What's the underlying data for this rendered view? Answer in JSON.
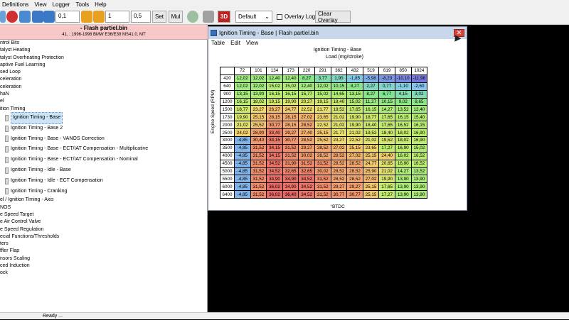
{
  "menu": [
    "Definitions",
    "View",
    "Logger",
    "Tools",
    "Help"
  ],
  "toolbar": {
    "field1": "0,1",
    "field2": "1",
    "field3": "0,5",
    "set_label": "Set",
    "mul_label": "Mul",
    "mode_label": "3D",
    "dropdown_value": "Default",
    "overlay_log_label": "Overlay Log",
    "clear_overlay_label": "Clear Overlay"
  },
  "left_panel": {
    "title": "- Flash partiel.bin",
    "subtitle": "41, ; 1996-1998 BMW E36/E39 MS41.0, MT"
  },
  "tree": [
    {
      "label": "ntrol Bits",
      "child": false
    },
    {
      "label": "talyst Heating",
      "child": false
    },
    {
      "label": "talyst Overheating Protection",
      "child": false
    },
    {
      "label": "aptive Fuel Learning",
      "child": false
    },
    {
      "label": "sed Loop",
      "child": false
    },
    {
      "label": "celeration",
      "child": false
    },
    {
      "label": "celeration",
      "child": false
    },
    {
      "label": "haN",
      "child": false
    },
    {
      "label": "el",
      "child": false
    },
    {
      "label": "ition Timing",
      "child": false
    },
    {
      "label": "Ignition Timing - Base",
      "child": true,
      "selected": true
    },
    {
      "label": "Ignition Timing - Base 2",
      "child": true
    },
    {
      "label": "Ignition Timing - Base - VANOS Correction",
      "child": true
    },
    {
      "label": "Ignition Timing - Base - ECT/IAT Compensation - Multiplicative",
      "child": true
    },
    {
      "label": "Ignition Timing - Base - ECT/IAT Compensation - Nominal",
      "child": true
    },
    {
      "label": "Ignition Timing - Idle - Base",
      "child": true
    },
    {
      "label": "Ignition Timing - Idle - ECT Compensation",
      "child": true
    },
    {
      "label": "Ignition Timing - Cranking",
      "child": true
    },
    {
      "label": "el / Ignition Timing - Axis",
      "child": false
    },
    {
      "label": "NOS",
      "child": false
    },
    {
      "label": "e Speed Target",
      "child": false
    },
    {
      "label": "e Air Control Valve",
      "child": false
    },
    {
      "label": "e Speed Regulation",
      "child": false
    },
    {
      "label": "ecial Functions/Thresholds",
      "child": false
    },
    {
      "label": "ters",
      "child": false
    },
    {
      "label": "ffler Flap",
      "child": false
    },
    {
      "label": "nsors Scaling",
      "child": false
    },
    {
      "label": "ced Induction",
      "child": false
    },
    {
      "label": "ock",
      "child": false
    }
  ],
  "status": "Ready ...",
  "window": {
    "title": "Ignition Timing - Base | Flash partiel.bin",
    "menu": [
      "Table",
      "Edit",
      "View"
    ],
    "table_title": "Ignition Timing - Base",
    "x_axis_label": "Load (mg/stroke)",
    "y_axis_label": "Engine Speed (RPM)",
    "units_label": "°BTDC",
    "close_glyph": "✕"
  },
  "chart_data": {
    "type": "table",
    "columns": [
      "72",
      "101",
      "134",
      "173",
      "220",
      "291",
      "362",
      "432",
      "519",
      "619",
      "850",
      "1024"
    ],
    "rows": [
      "420",
      "640",
      "900",
      "1200",
      "1500",
      "1730",
      "2000",
      "2500",
      "3000",
      "3500",
      "4000",
      "4500",
      "5000",
      "5500",
      "6000",
      "6400"
    ],
    "values": [
      [
        "12,02",
        "12,02",
        "12,40",
        "12,40",
        "8,27",
        "3,77",
        "1,90",
        "-1,85",
        "-5,98",
        "-8,23",
        "-10,10",
        "-11,98"
      ],
      [
        "12,02",
        "12,02",
        "15,02",
        "15,02",
        "12,40",
        "12,02",
        "10,15",
        "8,27",
        "2,27",
        "0,77",
        "-1,10",
        "-2,60"
      ],
      [
        "13,15",
        "13,90",
        "16,15",
        "16,15",
        "15,77",
        "15,02",
        "14,65",
        "13,15",
        "8,27",
        "6,77",
        "4,15",
        "3,02"
      ],
      [
        "16,15",
        "18,02",
        "19,15",
        "19,90",
        "20,27",
        "19,15",
        "18,40",
        "15,02",
        "11,27",
        "10,15",
        "9,02",
        "8,65"
      ],
      [
        "18,77",
        "23,27",
        "26,27",
        "24,77",
        "22,52",
        "21,77",
        "19,52",
        "17,65",
        "16,15",
        "14,27",
        "13,52",
        "12,40"
      ],
      [
        "19,90",
        "25,15",
        "28,15",
        "28,15",
        "27,02",
        "23,65",
        "21,02",
        "19,90",
        "18,77",
        "17,65",
        "16,15",
        "15,40"
      ],
      [
        "21,02",
        "25,52",
        "30,77",
        "28,15",
        "28,52",
        "22,52",
        "21,02",
        "19,90",
        "18,40",
        "17,65",
        "16,52",
        "16,15"
      ],
      [
        "24,02",
        "28,90",
        "33,40",
        "29,27",
        "27,40",
        "25,15",
        "21,77",
        "21,02",
        "19,52",
        "18,40",
        "18,02",
        "16,90"
      ],
      [
        "-4,85",
        "30,40",
        "34,15",
        "30,77",
        "28,52",
        "25,52",
        "23,27",
        "22,52",
        "21,02",
        "19,52",
        "18,02",
        "16,90"
      ],
      [
        "-4,85",
        "31,52",
        "34,15",
        "31,52",
        "29,27",
        "28,52",
        "27,02",
        "25,15",
        "23,65",
        "17,27",
        "16,90",
        "15,02"
      ],
      [
        "-4,85",
        "31,52",
        "34,15",
        "31,52",
        "30,02",
        "28,52",
        "28,52",
        "27,02",
        "25,15",
        "24,40",
        "16,02",
        "16,52"
      ],
      [
        "-4,85",
        "31,52",
        "34,52",
        "31,90",
        "31,52",
        "31,52",
        "28,52",
        "28,52",
        "24,77",
        "20,65",
        "16,90",
        "16,52"
      ],
      [
        "-4,85",
        "31,52",
        "34,52",
        "32,65",
        "32,65",
        "30,02",
        "28,52",
        "28,52",
        "25,90",
        "21,02",
        "14,27",
        "13,52"
      ],
      [
        "-4,85",
        "31,52",
        "34,90",
        "34,90",
        "34,52",
        "31,52",
        "28,52",
        "28,52",
        "27,02",
        "19,90",
        "13,90",
        "13,90"
      ],
      [
        "-4,85",
        "31,52",
        "36,02",
        "34,90",
        "34,52",
        "31,52",
        "29,27",
        "29,27",
        "25,15",
        "17,65",
        "13,90",
        "13,90"
      ],
      [
        "-4,85",
        "31,52",
        "36,02",
        "36,40",
        "34,52",
        "31,52",
        "30,77",
        "30,77",
        "25,15",
        "17,27",
        "13,90",
        "13,90"
      ]
    ]
  }
}
